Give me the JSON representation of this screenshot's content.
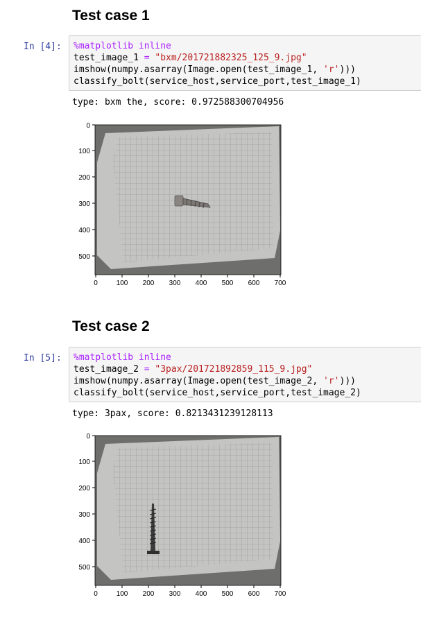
{
  "cells": [
    {
      "heading": "Test case 1",
      "prompt": "In [4]:",
      "code": {
        "magic": "%matplotlib inline",
        "line2_var": "test_image_1",
        "line2_op": "=",
        "line2_str": "\"bxm/201721882325_125_9.jpg\"",
        "line3_a": "imshow(numpy.asarray(Image.open(test_image_1, ",
        "line3_str": "'r'",
        "line3_b": ")))",
        "line4": "classify_bolt(service_host,service_port,test_image_1)"
      },
      "output": "type: bxm the, score: 0.972588300704956",
      "image": {
        "y_ticks": [
          "0",
          "100",
          "200",
          "300",
          "400",
          "500"
        ],
        "x_ticks": [
          "0",
          "100",
          "200",
          "300",
          "400",
          "500",
          "600",
          "700"
        ],
        "bolt": "hex-bolt-horizontal"
      }
    },
    {
      "heading": "Test case 2",
      "prompt": "In [5]:",
      "code": {
        "magic": "%matplotlib inline",
        "line2_var": "test_image_2",
        "line2_op": "=",
        "line2_str": "\"3pax/201721892859_115_9.jpg\"",
        "line3_a": "imshow(numpy.asarray(Image.open(test_image_2, ",
        "line3_str": "'r'",
        "line3_b": ")))",
        "line4": "classify_bolt(service_host,service_port,test_image_2)"
      },
      "output": "type: 3pax, score: 0.8213431239128113",
      "image": {
        "y_ticks": [
          "0",
          "100",
          "200",
          "300",
          "400",
          "500"
        ],
        "x_ticks": [
          "0",
          "100",
          "200",
          "300",
          "400",
          "500",
          "600",
          "700"
        ],
        "bolt": "screw-vertical"
      }
    }
  ]
}
